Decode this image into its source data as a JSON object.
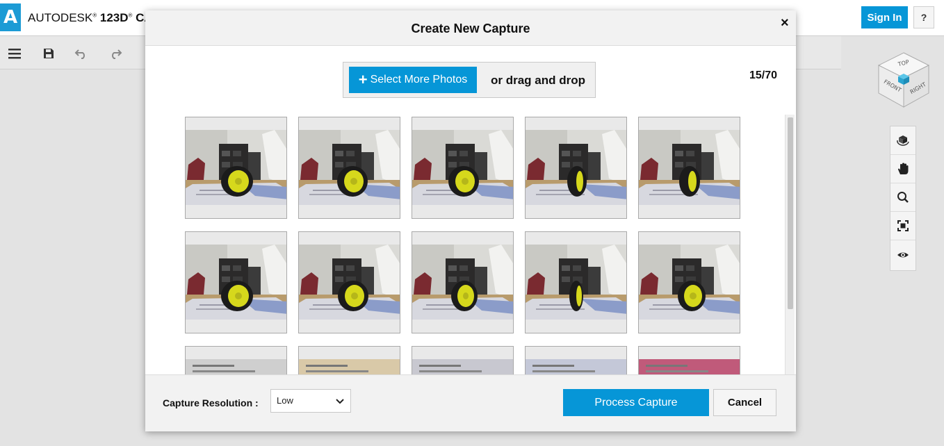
{
  "app": {
    "brand_company": "AUTODESK",
    "brand_product": "123D",
    "brand_suffix": "CAT",
    "sign_in_label": "Sign In",
    "help_label": "?"
  },
  "toolbar": {
    "icons": [
      "menu-icon",
      "save-icon",
      "undo-icon",
      "redo-icon"
    ]
  },
  "view_cube": {
    "top_label": "TOP",
    "front_label": "FRONT",
    "right_label": "RIGHT"
  },
  "nav_palette": {
    "icons": [
      "orbit-icon",
      "pan-hand-icon",
      "zoom-icon",
      "fit-view-icon",
      "eye-icon"
    ]
  },
  "modal": {
    "title": "Create New Capture",
    "close_label": "×",
    "select_more_label": "Select More Photos",
    "drag_drop_text": "or drag and drop",
    "photo_count": "15/70",
    "resolution_label": "Capture Resolution :",
    "resolution_value": "Low",
    "process_label": "Process Capture",
    "cancel_label": "Cancel"
  },
  "colors": {
    "accent": "#0696d7",
    "wheel_yellow": "#d6d81c"
  }
}
